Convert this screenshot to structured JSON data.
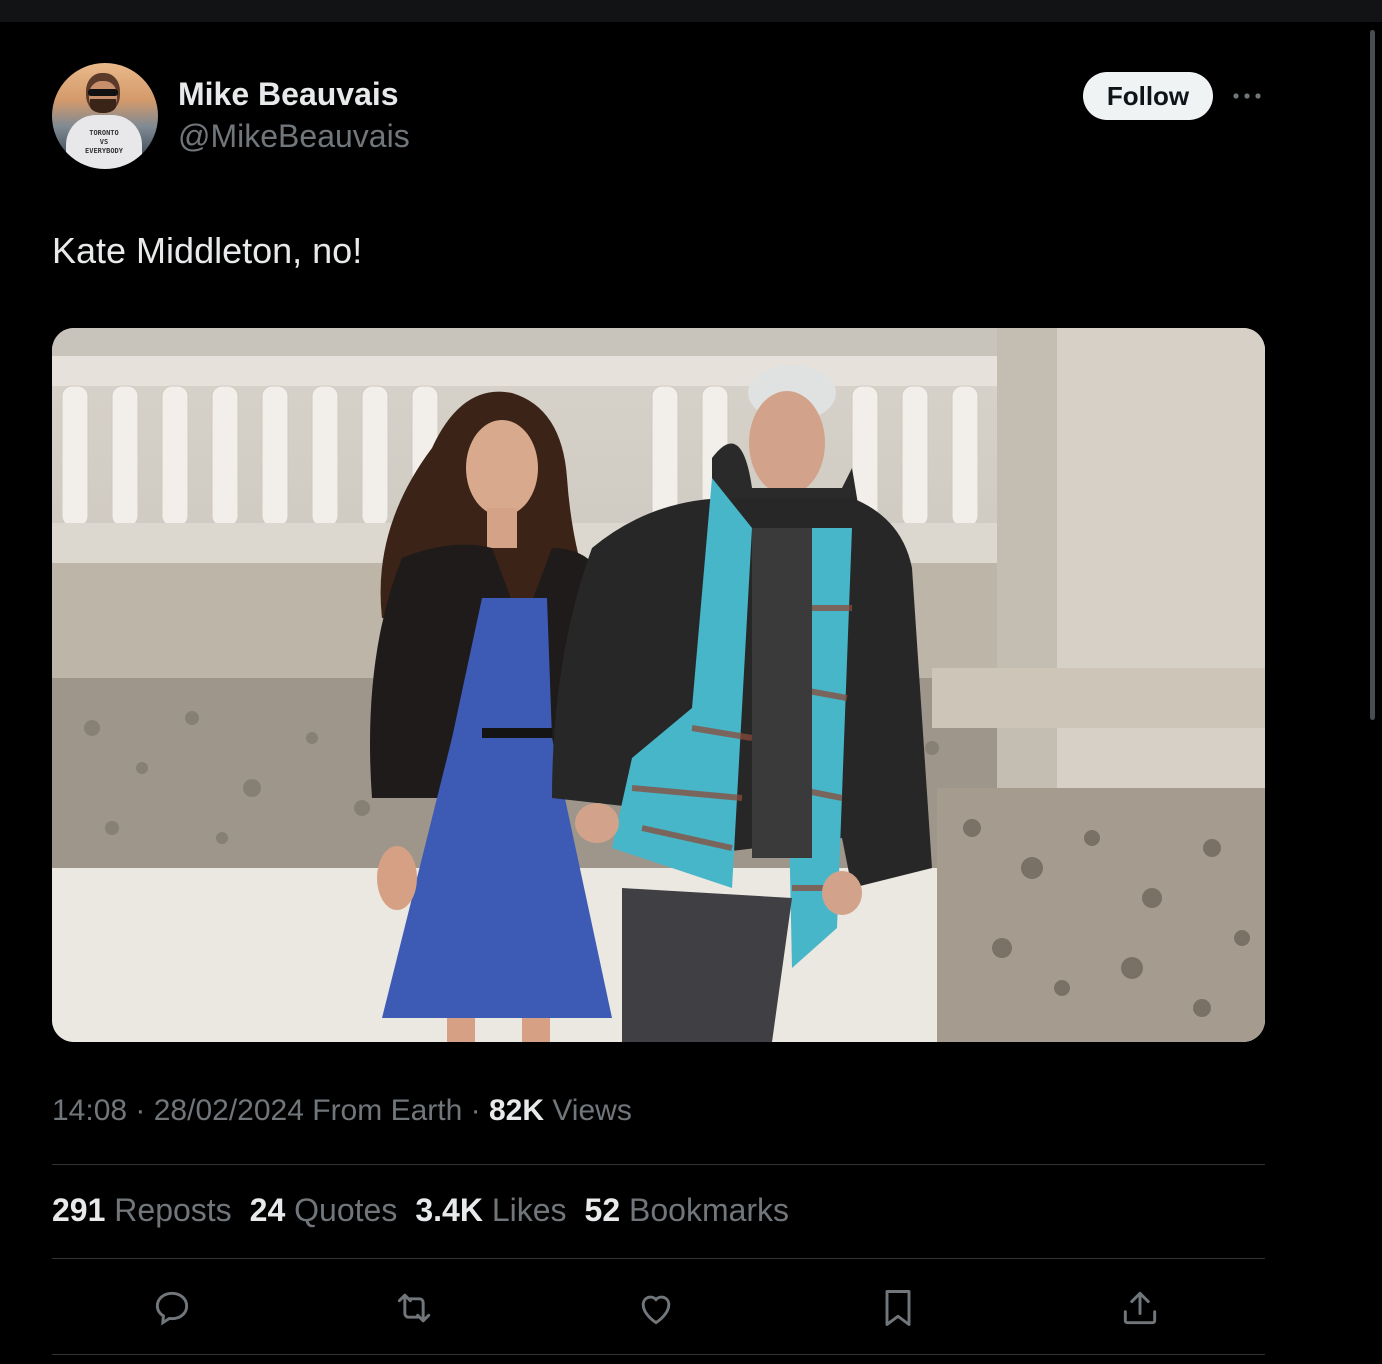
{
  "author": {
    "name": "Mike Beauvais",
    "handle": "@MikeBeauvais",
    "avatar_shirt_text": [
      "TORONTO",
      "VS",
      "EVERYBODY"
    ]
  },
  "follow_label": "Follow",
  "tweet": {
    "text": "Kate Middleton, no!"
  },
  "meta": {
    "time": "14:08",
    "sep1": " · ",
    "date": "28/02/2024",
    "source": " From Earth",
    "sep2": " · ",
    "views_count": "82K",
    "views_label": " Views"
  },
  "stats": [
    {
      "count": "291",
      "label": "Reposts"
    },
    {
      "count": "24",
      "label": "Quotes"
    },
    {
      "count": "3.4K",
      "label": "Likes"
    },
    {
      "count": "52",
      "label": "Bookmarks"
    }
  ],
  "actions": [
    "reply-icon",
    "repost-icon",
    "like-icon",
    "bookmark-icon",
    "share-icon"
  ],
  "colors": {
    "background": "#000000",
    "text_primary": "#e7e9ea",
    "text_secondary": "#71767b",
    "divider": "#2f3336",
    "follow_bg": "#eff3f4"
  }
}
